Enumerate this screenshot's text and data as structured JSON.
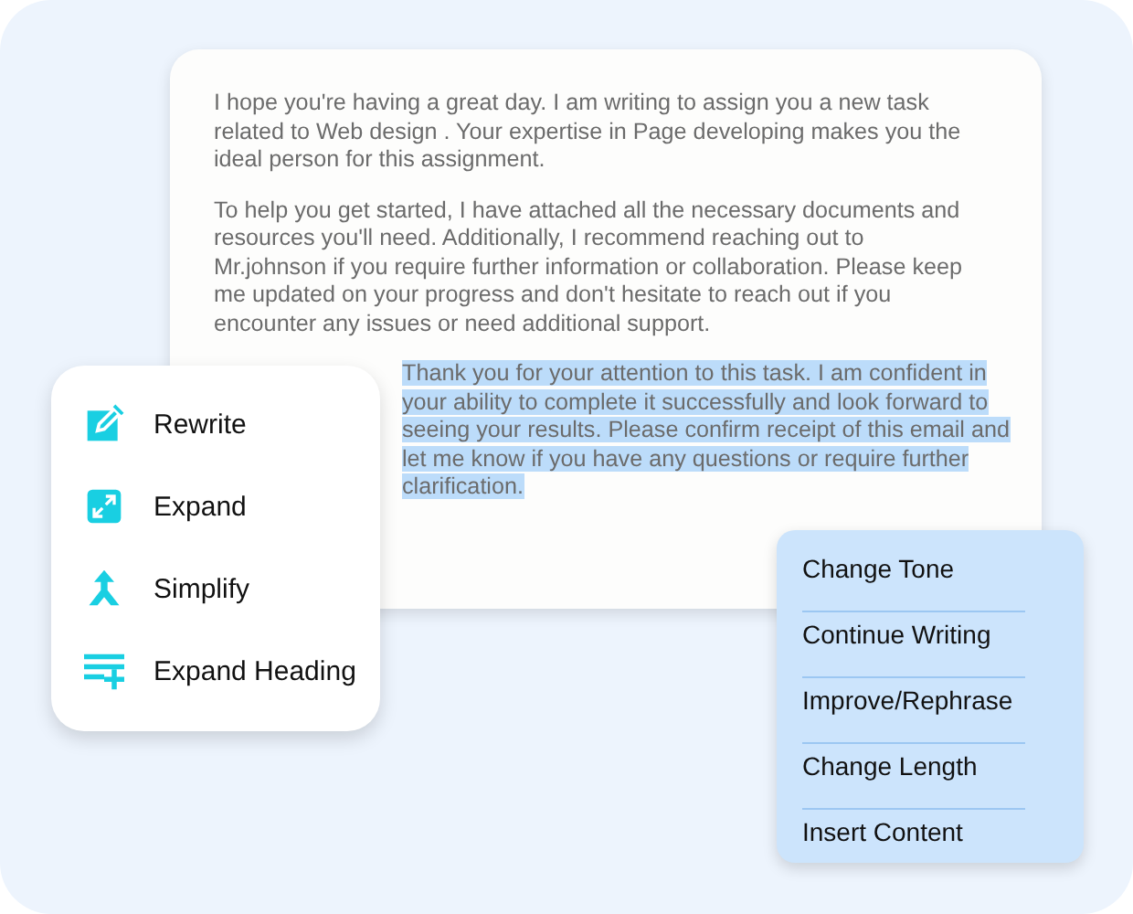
{
  "document": {
    "paragraphs": [
      {
        "text": "I hope you're having a great day. I am writing to assign you a new task related to Web design . Your expertise in Page developing makes you the ideal person for this assignment.",
        "selected": false
      },
      {
        "text": "To help you get started, I have attached all the necessary documents and resources you'll need. Additionally, I recommend reaching out to Mr.johnson if you require further information or collaboration. Please keep me updated on your progress and don't hesitate to reach out if you encounter any issues or need additional support.",
        "selected": false
      },
      {
        "text": "Thank you for your attention to this task. I am confident in your ability to complete it successfully and look forward to seeing your results. Please confirm receipt of this email and let me know if you have any questions or require further clarification.",
        "selected": true
      }
    ]
  },
  "ai_menu": {
    "items": [
      {
        "label": "Rewrite",
        "kind": "rewrite"
      },
      {
        "label": "Expand",
        "kind": "expand"
      },
      {
        "label": "Simplify",
        "kind": "simplify"
      },
      {
        "label": "Expand Heading",
        "kind": "heading"
      }
    ]
  },
  "options_menu": {
    "items": [
      "Change Tone",
      "Continue Writing",
      "Improve/Rephrase",
      "Change Length",
      "Insert Content"
    ]
  }
}
